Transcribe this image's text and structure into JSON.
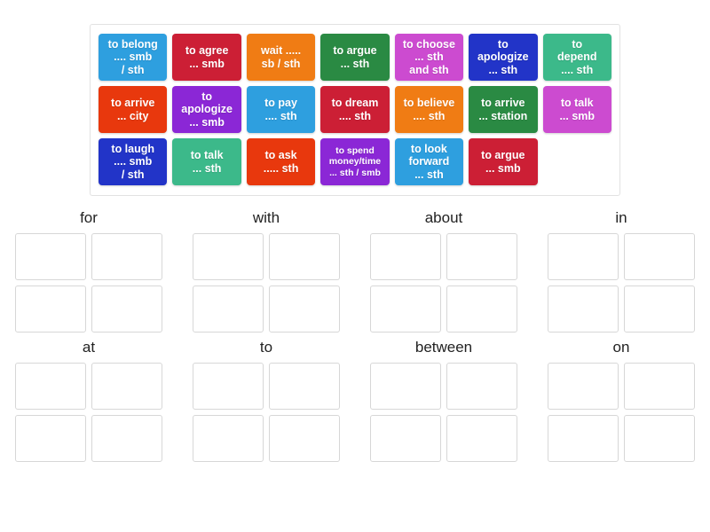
{
  "activity": {
    "type": "drag-and-drop-group-sort",
    "tile_rows": [
      [
        {
          "label": "to belong\n.... smb\n/ sth",
          "color": "#2e9fdf",
          "size": "normal"
        },
        {
          "label": "to agree\n... smb",
          "color": "#cc1f35",
          "size": "normal"
        },
        {
          "label": "wait .....\nsb / sth",
          "color": "#f07c14",
          "size": "normal"
        },
        {
          "label": "to argue\n... sth",
          "color": "#2a8a43",
          "size": "normal"
        },
        {
          "label": "to choose\n... sth\nand sth",
          "color": "#cc4bd0",
          "size": "normal"
        },
        {
          "label": "to\napologize\n... sth",
          "color": "#2234c8",
          "size": "normal"
        },
        {
          "label": "to\ndepend\n.... sth",
          "color": "#3cb98a",
          "size": "normal"
        }
      ],
      [
        {
          "label": "to arrive\n... city",
          "color": "#e8380d",
          "size": "normal"
        },
        {
          "label": "to\napologize\n... smb",
          "color": "#8b27d6",
          "size": "normal"
        },
        {
          "label": "to pay\n.... sth",
          "color": "#2e9fdf",
          "size": "normal"
        },
        {
          "label": "to dream\n.... sth",
          "color": "#cc1f35",
          "size": "normal"
        },
        {
          "label": "to believe\n.... sth",
          "color": "#f07c14",
          "size": "normal"
        },
        {
          "label": "to arrive\n... station",
          "color": "#2a8a43",
          "size": "normal"
        },
        {
          "label": "to talk\n... smb",
          "color": "#cc4bd0",
          "size": "normal"
        }
      ],
      [
        {
          "label": "to laugh\n.... smb\n/ sth",
          "color": "#2234c8",
          "size": "normal"
        },
        {
          "label": "to talk\n... sth",
          "color": "#3cb98a",
          "size": "normal"
        },
        {
          "label": "to ask\n..... sth",
          "color": "#e8380d",
          "size": "normal"
        },
        {
          "label": "to spend\nmoney/time\n... sth / smb",
          "color": "#8b27d6",
          "size": "small"
        },
        {
          "label": "to look\nforward\n... sth",
          "color": "#2e9fdf",
          "size": "normal"
        },
        {
          "label": "to argue\n... smb",
          "color": "#cc1f35",
          "size": "normal"
        },
        {
          "label": "",
          "color": "transparent",
          "size": "empty"
        }
      ]
    ],
    "group_rows": [
      [
        {
          "title": "for",
          "slots": 4
        },
        {
          "title": "with",
          "slots": 4
        },
        {
          "title": "about",
          "slots": 4
        },
        {
          "title": "in",
          "slots": 4
        }
      ],
      [
        {
          "title": "at",
          "slots": 4
        },
        {
          "title": "to",
          "slots": 4
        },
        {
          "title": "between",
          "slots": 4
        },
        {
          "title": "on",
          "slots": 4
        }
      ]
    ]
  }
}
